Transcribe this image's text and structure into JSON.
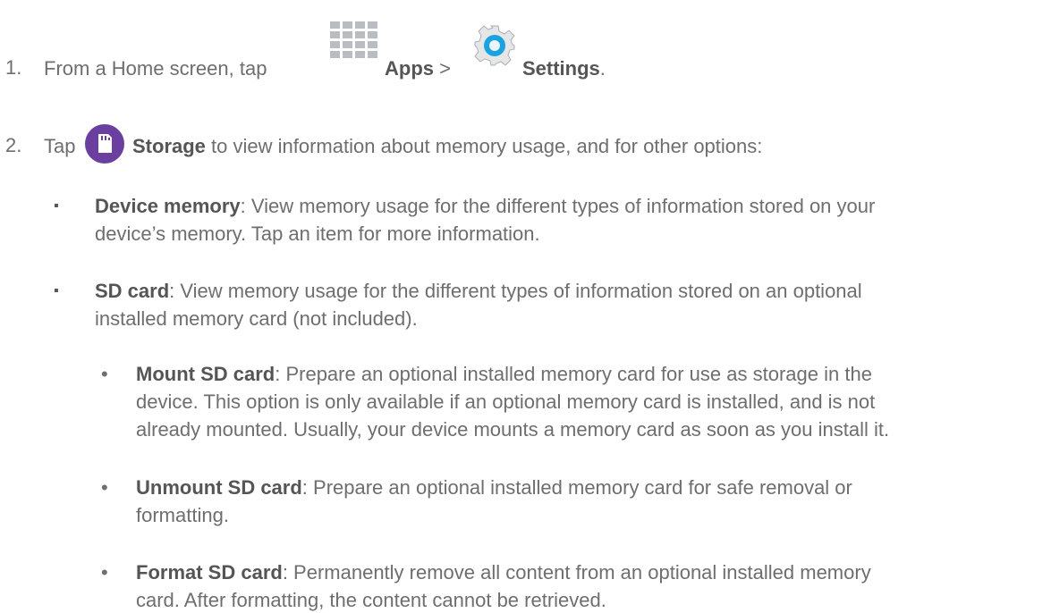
{
  "steps": [
    {
      "number": "1.",
      "pre": "From a Home screen, tap",
      "apps_label": "Apps",
      "separator": ">",
      "settings_label": "Settings",
      "end": "."
    },
    {
      "number": "2.",
      "pre": "Tap",
      "storage_label": "Storage",
      "post": "to view information about memory usage, and for other options:"
    }
  ],
  "bullets": [
    {
      "term": "Device memory",
      "line1": ": View memory usage for the different types of information stored on your",
      "line2": "device’s memory. Tap an item for more information."
    },
    {
      "term": "SD card",
      "line1": ": View memory usage for the different types of information stored on an optional",
      "line2": "installed memory card (not included)."
    }
  ],
  "subbullets": [
    {
      "term": "Mount SD card",
      "line1": ": Prepare an optional installed memory card for use as storage in the",
      "line2": "device. This option is only available if an optional memory card is installed, and is not",
      "line3": "already mounted. Usually, your device mounts a memory card as soon as you install it."
    },
    {
      "term": "Unmount SD card",
      "line1": ": Prepare an optional installed memory card for safe removal or",
      "line2": "formatting."
    },
    {
      "term": "Format SD card",
      "line1": ": Permanently remove all content from an optional installed memory",
      "line2": "card. After formatting, the content cannot be retrieved."
    }
  ],
  "bullet_symbols": {
    "square": "▪",
    "dot": "•"
  },
  "icons": {
    "apps": "apps-grid-icon",
    "settings": "settings-gear-icon",
    "storage": "storage-sd-card-icon"
  },
  "colors": {
    "text": "#6e6e6e",
    "bold": "#555555",
    "settings_blue": "#1aa3e0",
    "storage_purple": "#6b3fa0"
  }
}
